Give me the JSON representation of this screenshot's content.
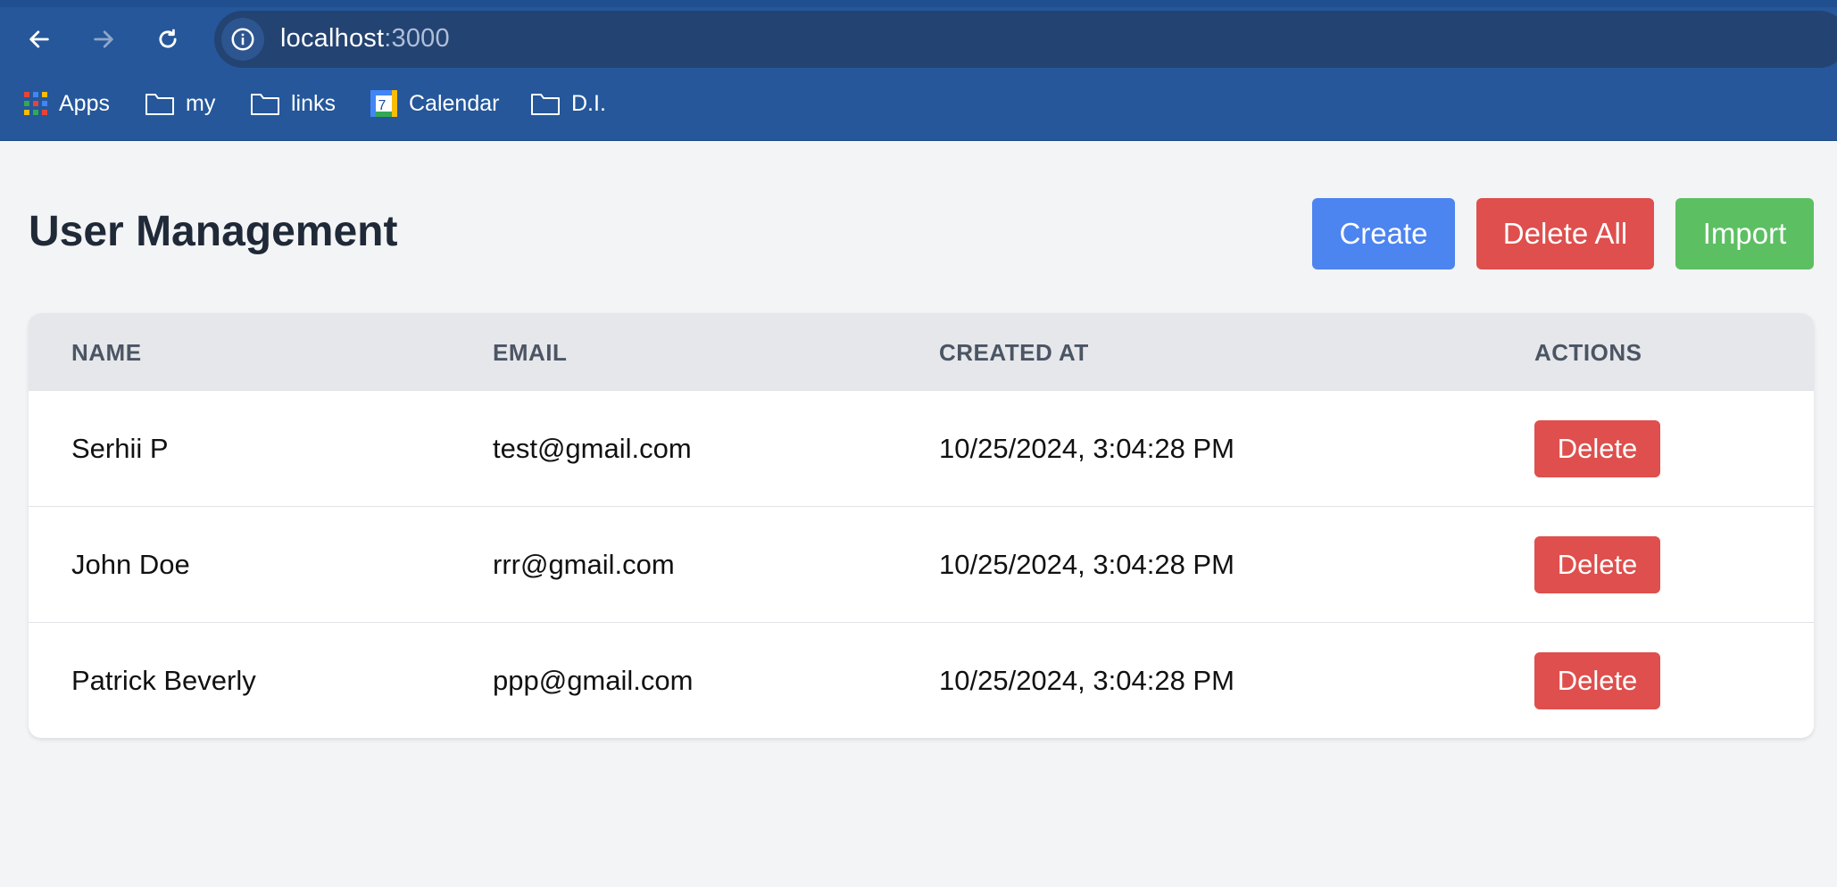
{
  "browser": {
    "url_host": "localhost",
    "url_port": ":3000",
    "bookmarks": [
      {
        "label": "Apps",
        "icon": "apps-grid-icon"
      },
      {
        "label": "my",
        "icon": "folder-icon"
      },
      {
        "label": "links",
        "icon": "folder-icon"
      },
      {
        "label": "Calendar",
        "icon": "calendar-icon",
        "badge": "7"
      },
      {
        "label": "D.I.",
        "icon": "folder-icon"
      }
    ]
  },
  "page": {
    "title": "User Management",
    "buttons": {
      "create": "Create",
      "delete_all": "Delete All",
      "import": "Import"
    }
  },
  "table": {
    "columns": [
      "NAME",
      "EMAIL",
      "CREATED AT",
      "ACTIONS"
    ],
    "rows": [
      {
        "name": "Serhii P",
        "email": "test@gmail.com",
        "created_at": "10/25/2024, 3:04:28 PM",
        "action": "Delete"
      },
      {
        "name": "John Doe",
        "email": "rrr@gmail.com",
        "created_at": "10/25/2024, 3:04:28 PM",
        "action": "Delete"
      },
      {
        "name": "Patrick Beverly",
        "email": "ppp@gmail.com",
        "created_at": "10/25/2024, 3:04:28 PM",
        "action": "Delete"
      }
    ]
  },
  "colors": {
    "chrome": "#25579a",
    "create": "#4c84f0",
    "delete": "#de4f4d",
    "import": "#5cbf62"
  }
}
